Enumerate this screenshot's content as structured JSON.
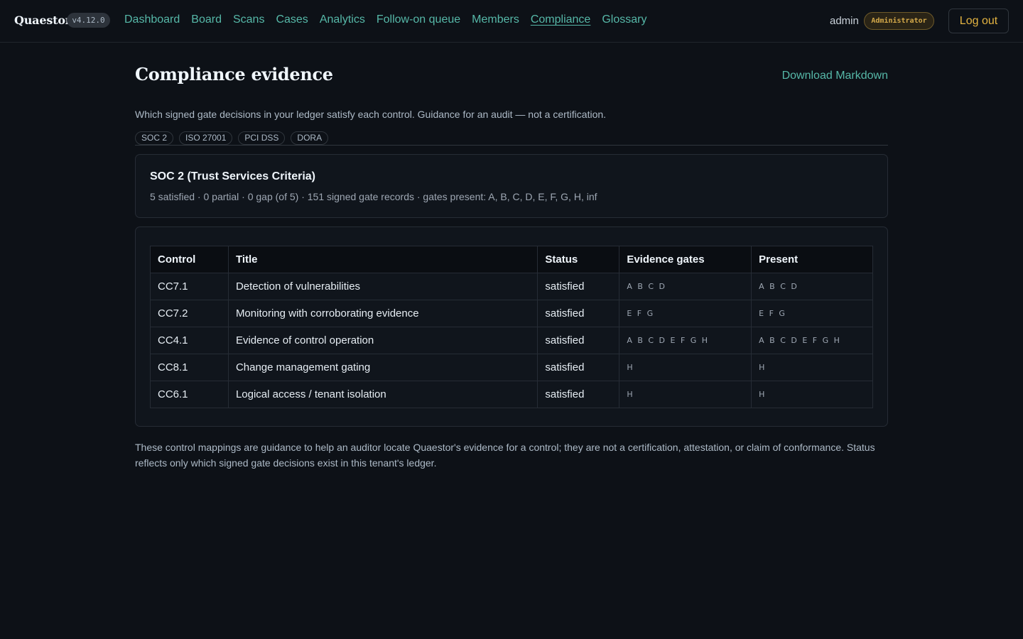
{
  "app": {
    "brand": "Quaestor",
    "version": "v4.12.0"
  },
  "nav": {
    "items": [
      {
        "label": "Dashboard"
      },
      {
        "label": "Board"
      },
      {
        "label": "Scans"
      },
      {
        "label": "Cases"
      },
      {
        "label": "Analytics"
      },
      {
        "label": "Follow-on queue"
      },
      {
        "label": "Members"
      },
      {
        "label": "Compliance",
        "active": true
      },
      {
        "label": "Glossary"
      }
    ],
    "user": "admin",
    "role": "Administrator",
    "logout_label": "Log out"
  },
  "page": {
    "title": "Compliance evidence",
    "download_label": "Download Markdown",
    "subtitle": "Which signed gate decisions in your ledger satisfy each control. Guidance for an audit — not a certification.",
    "frameworks": [
      "SOC 2",
      "ISO 27001",
      "PCI DSS",
      "DORA"
    ],
    "selected_framework": "SOC 2"
  },
  "summary": {
    "title": "SOC 2 (Trust Services Criteria)",
    "meta": "5 satisfied · 0 partial · 0 gap (of 5) · 151 signed gate records · gates present: A, B, C, D, E, F, G, H, inf"
  },
  "table": {
    "headers": [
      "Control",
      "Title",
      "Status",
      "Evidence gates",
      "Present"
    ],
    "rows": [
      {
        "control": "CC7.1",
        "title": "Detection of vulnerabilities",
        "status": "satisfied",
        "evidence": "A B C D",
        "present": "A B C D"
      },
      {
        "control": "CC7.2",
        "title": "Monitoring with corroborating evidence",
        "status": "satisfied",
        "evidence": "E F G",
        "present": "E F G"
      },
      {
        "control": "CC4.1",
        "title": "Evidence of control operation",
        "status": "satisfied",
        "evidence": "A B C D E F G H",
        "present": "A B C D E F G H"
      },
      {
        "control": "CC8.1",
        "title": "Change management gating",
        "status": "satisfied",
        "evidence": "H",
        "present": "H"
      },
      {
        "control": "CC6.1",
        "title": "Logical access / tenant isolation",
        "status": "satisfied",
        "evidence": "H",
        "present": "H"
      }
    ]
  },
  "footnote": "These control mappings are guidance to help an auditor locate Quaestor's evidence for a control; they are not a certification, attestation, or claim of conformance. Status reflects only which signed gate decisions exist in this tenant's ledger.",
  "colors": {
    "background": "#0d1117",
    "link": "#56b8a8",
    "accent_gold": "#e3b341"
  }
}
